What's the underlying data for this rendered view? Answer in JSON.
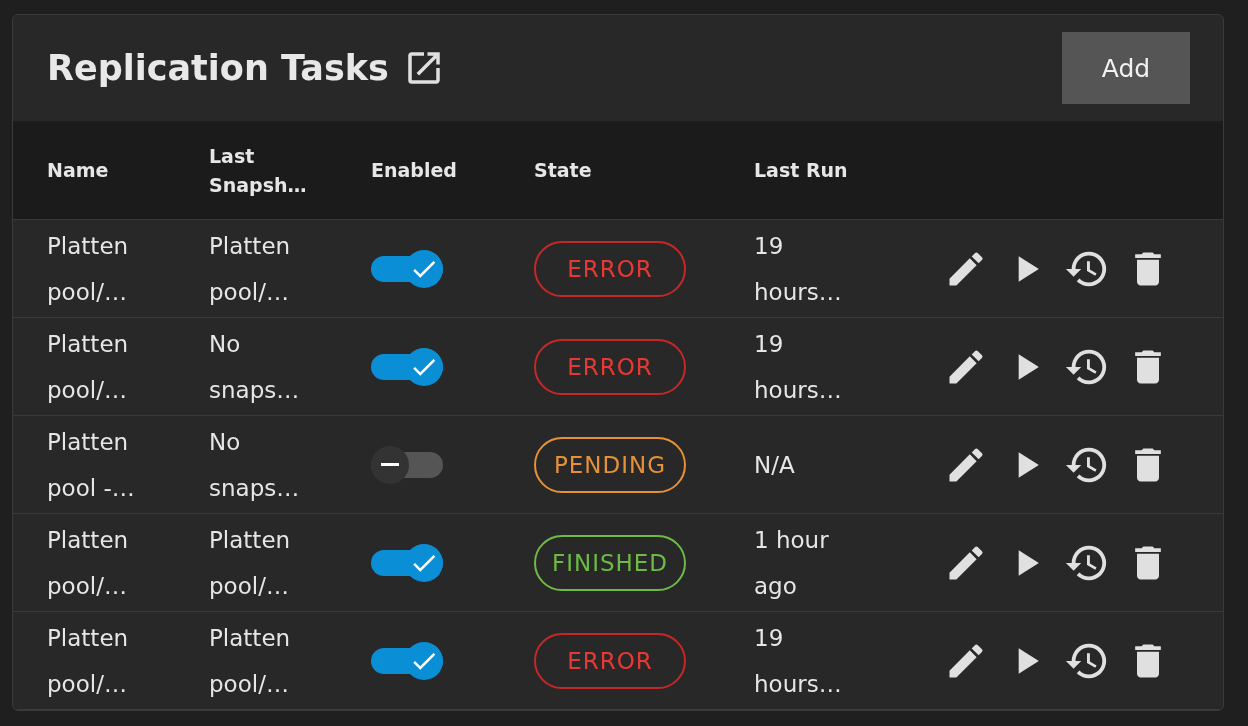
{
  "title": "Replication Tasks",
  "add_button": "Add",
  "columns": [
    "Name",
    "Last Snapsh…",
    "Enabled",
    "State",
    "Last Run"
  ],
  "rows": [
    {
      "name": "Platten pool/…",
      "last_snapshot": "Platten pool/…",
      "enabled": true,
      "state": {
        "label": "ERROR",
        "kind": "error"
      },
      "last_run": "19 hours…"
    },
    {
      "name": "Platten pool/…",
      "last_snapshot": "No snaps…",
      "enabled": true,
      "state": {
        "label": "ERROR",
        "kind": "error"
      },
      "last_run": "19 hours…"
    },
    {
      "name": "Platten pool -…",
      "last_snapshot": "No snaps…",
      "enabled": false,
      "state": {
        "label": "PENDING",
        "kind": "pending"
      },
      "last_run": "N/A"
    },
    {
      "name": "Platten pool/…",
      "last_snapshot": "Platten pool/…",
      "enabled": true,
      "state": {
        "label": "FINISHED",
        "kind": "finished"
      },
      "last_run": "1 hour ago"
    },
    {
      "name": "Platten pool/…",
      "last_snapshot": "Platten pool/…",
      "enabled": true,
      "state": {
        "label": "ERROR",
        "kind": "error"
      },
      "last_run": "19 hours…"
    }
  ]
}
